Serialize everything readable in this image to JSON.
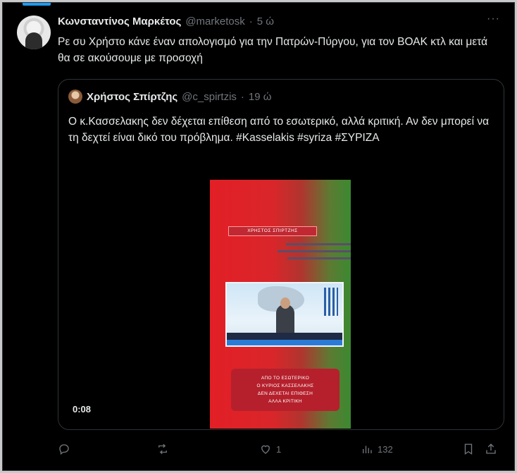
{
  "tweet": {
    "author_name": "Κωνσταντίνος Μαρκέτος",
    "handle": "@marketosk",
    "separator": "·",
    "time": "5 ώ",
    "more": "···",
    "text": "Ρε συ Χρήστο κάνε έναν απολογισμό για την Πατρών-Πύργου, για τον ΒΟΑΚ κτλ και μετά θα σε ακούσουμε με προσοχή"
  },
  "quote": {
    "author_name": "Χρήστος Σπίρτζης",
    "handle": "@c_spirtzis",
    "separator": "·",
    "time": "19 ώ",
    "text_main": "Ο κ.Κασσελακης δεν δέχεται επίθεση από το εσωτερικό, αλλά κριτική. Αν δεν μπορεί να τη δεχτεί είναι δικό του πρόβλημα.",
    "hashtag_1": "#Kasselakis",
    "hashtag_2": "#syriza",
    "hashtag_3": "#ΣΥΡΙΖΑ",
    "video": {
      "banner": "ΧΡΗΣΤΟΣ ΣΠΙΡΤΖΗΣ",
      "caption_1": "ΑΠΟ ΤΟ ΕΣΩΤΕΡΙΚΟ",
      "caption_2": "Ο ΚΥΡΙΟΣ ΚΑΣΣΕΛΑΚΗΣ",
      "caption_3": "ΔΕΝ ΔΕΧΕΤΑΙ ΕΠΙΘΕΣΗ",
      "caption_4": "ΑΛΛΑ ΚΡΙΤΙΚΗ",
      "duration": "0:08"
    }
  },
  "actions": {
    "reply_icon": "reply-icon",
    "retweet_icon": "retweet-icon",
    "like_count": "1",
    "views_count": "132"
  },
  "colors": {
    "background": "#000000",
    "text": "#e7e9ea",
    "muted": "#71767b",
    "border": "#2f3336"
  }
}
